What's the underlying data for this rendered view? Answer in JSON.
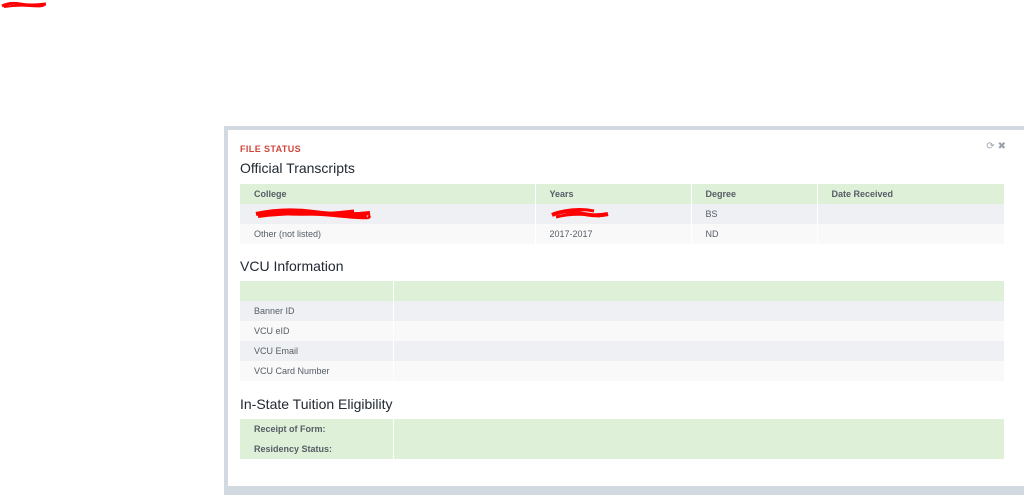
{
  "panel": {
    "header_label": "FILE STATUS",
    "tools": {
      "refresh_glyph": "⟳",
      "close_glyph": "✖"
    }
  },
  "transcripts": {
    "title": "Official Transcripts",
    "columns": [
      "College",
      "Years",
      "Degree",
      "Date Received"
    ],
    "rows": [
      {
        "college": "",
        "years": "",
        "degree": "BS",
        "date_received": ""
      },
      {
        "college": "Other (not listed)",
        "years": "2017-2017",
        "degree": "ND",
        "date_received": ""
      }
    ]
  },
  "vcu": {
    "title": "VCU Information",
    "header": [
      "",
      ""
    ],
    "rows": [
      {
        "label": "Banner ID",
        "value": ""
      },
      {
        "label": "VCU eID",
        "value": ""
      },
      {
        "label": "VCU Email",
        "value": ""
      },
      {
        "label": "VCU Card Number",
        "value": ""
      }
    ]
  },
  "tuition": {
    "title": "In-State Tuition Eligibility",
    "rows": [
      {
        "label": "Receipt of Form:",
        "value": ""
      },
      {
        "label": "Residency Status:",
        "value": ""
      }
    ]
  },
  "colors": {
    "accent_red": "#d0453a",
    "header_green": "#dff0d8",
    "zebra": "#eef0f3",
    "frame": "#d3d9e0"
  }
}
